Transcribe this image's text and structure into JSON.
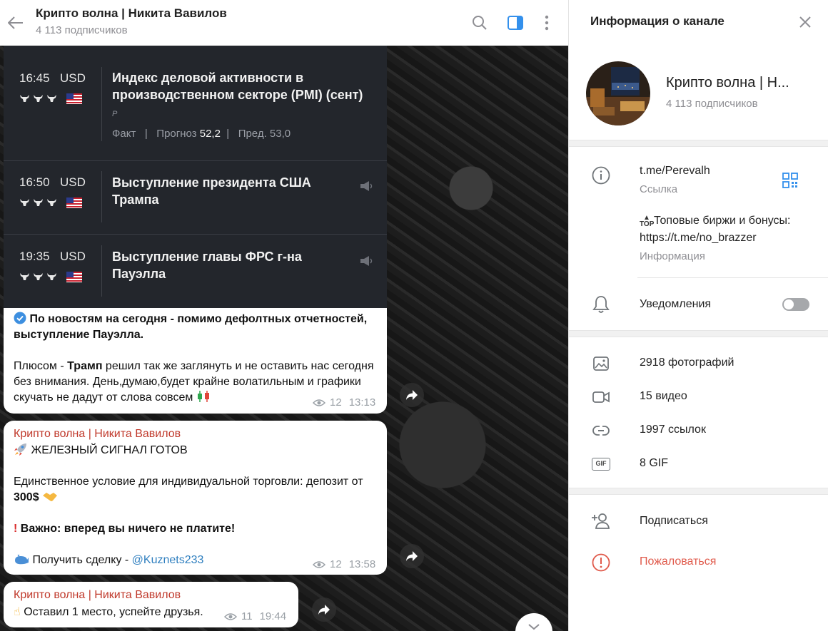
{
  "header": {
    "title": "Крипто волна | Никита Вавилов",
    "subscribers": "4 113 подписчиков"
  },
  "calendar": [
    {
      "time": "16:45",
      "currency": "USD",
      "event": "Индекс деловой активности в производственном секторе (PMI) (сент)",
      "stats_fact": "Факт",
      "stats_forecast_label": "Прогноз",
      "stats_forecast": "52,2",
      "stats_prev": "Пред. 53,0",
      "preliminary_mark": "P"
    },
    {
      "time": "16:50",
      "currency": "USD",
      "event": "Выступление президента США Трампа"
    },
    {
      "time": "19:35",
      "currency": "USD",
      "event": "Выступление главы ФРС г-на Пауэлла"
    }
  ],
  "messages": [
    {
      "line1": "По новостям на сегодня - помимо дефолтных отчетностей, выступление Пауэлла.",
      "line2_prefix": "Плюсом - ",
      "line2_bold": "Трамп",
      "line2_rest": " решил так же заглянуть и не оставить нас сегодня без внимания. День,думаю,будет крайне волатильным и графики скучать не дадут от слова совсем",
      "views": "12",
      "time": "13:13"
    },
    {
      "author": "Крипто волна | Никита Вавилов",
      "title": "ЖЕЛЕЗНЫЙ СИГНАЛ ГОТОВ",
      "condition_prefix": "Единственное условие для индивидуальной торговли: депозит от ",
      "condition_amount": "300$",
      "important": "Важно: вперед вы ничего не платите!",
      "deal_prefix": "Получить сделку - ",
      "deal_link": "@Kuznets233",
      "views": "12",
      "time": "13:58"
    },
    {
      "author": "Крипто волна | Никита Вавилов",
      "text": "Оставил 1 место, успейте друзья.",
      "views": "11",
      "time": "19:44"
    }
  ],
  "info_panel": {
    "title": "Информация о канале",
    "channel_name": "Крипто волна | Н...",
    "subscribers": "4 113 подписчиков",
    "link": "t.me/Perevalh",
    "link_label": "Ссылка",
    "description": "Топовые биржи и бонусы:",
    "description_link": "https://t.me/no_brazzer",
    "description_label": "Информация",
    "notifications": "Уведомления",
    "notifications_on": false,
    "media": {
      "photos": "2918 фотографий",
      "videos": "15 видео",
      "links": "1997 ссылок",
      "gifs": "8 GIF",
      "gif_badge": "GIF"
    },
    "subscribe": "Подписаться",
    "report": "Пожаловаться"
  },
  "colors": {
    "accent": "#3390ec",
    "link": "#2f7fbf",
    "author": "#c0392b",
    "report": "#e05a4b",
    "calendar_bg": "#23262c"
  }
}
